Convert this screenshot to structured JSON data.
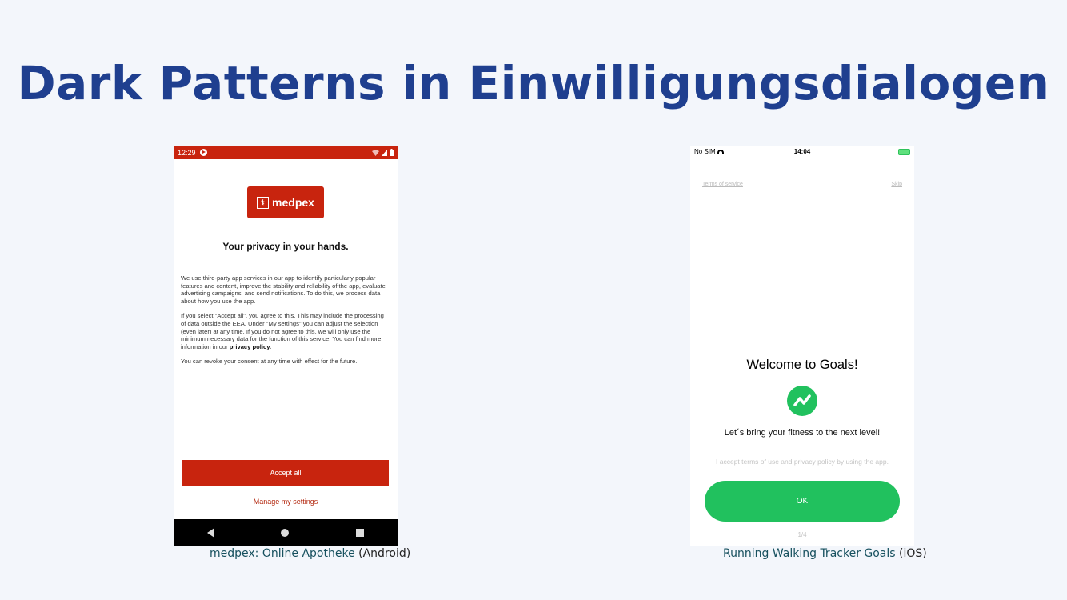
{
  "slide": {
    "title": "Dark Patterns in Einwilligungsdialogen"
  },
  "android": {
    "status_time": "12:29",
    "brand": "medpex",
    "heading": "Your privacy in your hands.",
    "body_p1": "We use third-party app services in our app to identify particularly popular features and content, improve the stability and reliability of the app, evaluate advertising campaigns, and send notifications. To do this, we process data about how you use the app.",
    "body_p2": "If you select \"Accept all\", you agree to this. This may include the processing of data outside the EEA. Under \"My settings\" you can adjust the selection (even later) at any time. If you do not agree to this, we will only use the minimum necessary data for the function of this service. You can find more information in our ",
    "privacy_link": "privacy policy.",
    "body_p3": "You can revoke your consent at any time with effect for the future.",
    "accept_label": "Accept all",
    "manage_label": "Manage my settings",
    "colors": {
      "brand": "#c8240e"
    }
  },
  "ios": {
    "carrier": "No SIM",
    "status_time": "14:04",
    "terms_link": "Terms of service",
    "skip_link": "Skip",
    "welcome": "Welcome to Goals!",
    "tagline": "Let´s bring your fitness to the next level!",
    "accept_note": "I accept terms of use and privacy policy by using the app.",
    "ok_label": "OK",
    "pager": "1/4",
    "colors": {
      "accent": "#21c15e"
    }
  },
  "captions": {
    "left_link": "medpex: Online Apotheke",
    "left_suffix": " (Android)",
    "right_link": "Running Walking Tracker Goals",
    "right_suffix": " (iOS)"
  }
}
